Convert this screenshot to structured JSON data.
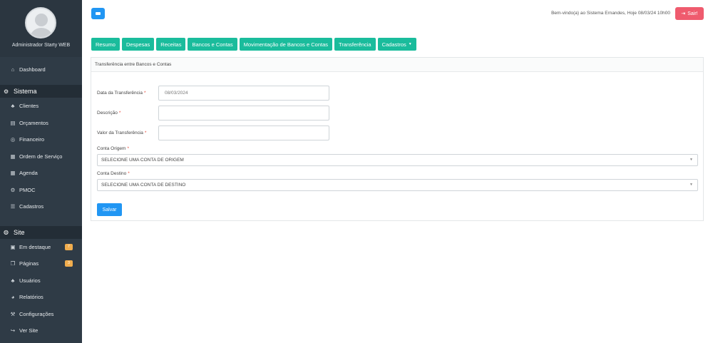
{
  "sidebar": {
    "user_name": "Administrador Starty WEB",
    "dashboard": "Dashboard",
    "sections": [
      {
        "title": "Sistema",
        "items": [
          {
            "label": "Clientes",
            "icon": "users-icon"
          },
          {
            "label": "Orçamentos",
            "icon": "document-icon"
          },
          {
            "label": "Financeiro",
            "icon": "money-icon"
          },
          {
            "label": "Ordem de Serviço",
            "icon": "list-icon"
          },
          {
            "label": "Agenda",
            "icon": "calendar-icon"
          },
          {
            "label": "PMOC",
            "icon": "gear-icon"
          },
          {
            "label": "Cadastros",
            "icon": "list-bullets-icon"
          }
        ]
      },
      {
        "title": "Site",
        "items": [
          {
            "label": "Em destaque",
            "icon": "image-icon",
            "badge": "7"
          },
          {
            "label": "Páginas",
            "icon": "pages-icon",
            "badge": "3"
          },
          {
            "label": "Usuários",
            "icon": "users-icon"
          },
          {
            "label": "Relatórios",
            "icon": "pie-chart-icon"
          },
          {
            "label": "Configurações",
            "icon": "wrench-icon"
          },
          {
            "label": "Ver Site",
            "icon": "share-icon"
          }
        ]
      }
    ]
  },
  "header": {
    "welcome": "Bem-vindo(a) ao Sistema Ernandes, Hoje 08/03/24 10h00",
    "logout": "Sair!"
  },
  "tabs": [
    "Resumo",
    "Despesas",
    "Receitas",
    "Bancos e Contas",
    "Movimentação de Bancos e Contas",
    "Transferência",
    "Cadastros"
  ],
  "panel": {
    "title": "Transferência entre Bancos e Contas",
    "fields": {
      "date_label": "Data da Transferência",
      "date_value": "08/03/2024",
      "description_label": "Descrição",
      "value_label": "Valor da Transferência",
      "origin_label": "Conta Origem",
      "origin_value": "SELECIONE UMA CONTA DE ORIGEM",
      "dest_label": "Conta Destino",
      "dest_value": "SELECIONE UMA CONTA DE DESTINO",
      "required_mark": "*"
    },
    "save": "Salvar"
  },
  "colors": {
    "sidebar_bg": "#2f3b46",
    "tab_green": "#1abc9c",
    "primary_blue": "#2196f3",
    "logout_red": "#ef5b6e",
    "badge_orange": "#f0ad4e"
  }
}
